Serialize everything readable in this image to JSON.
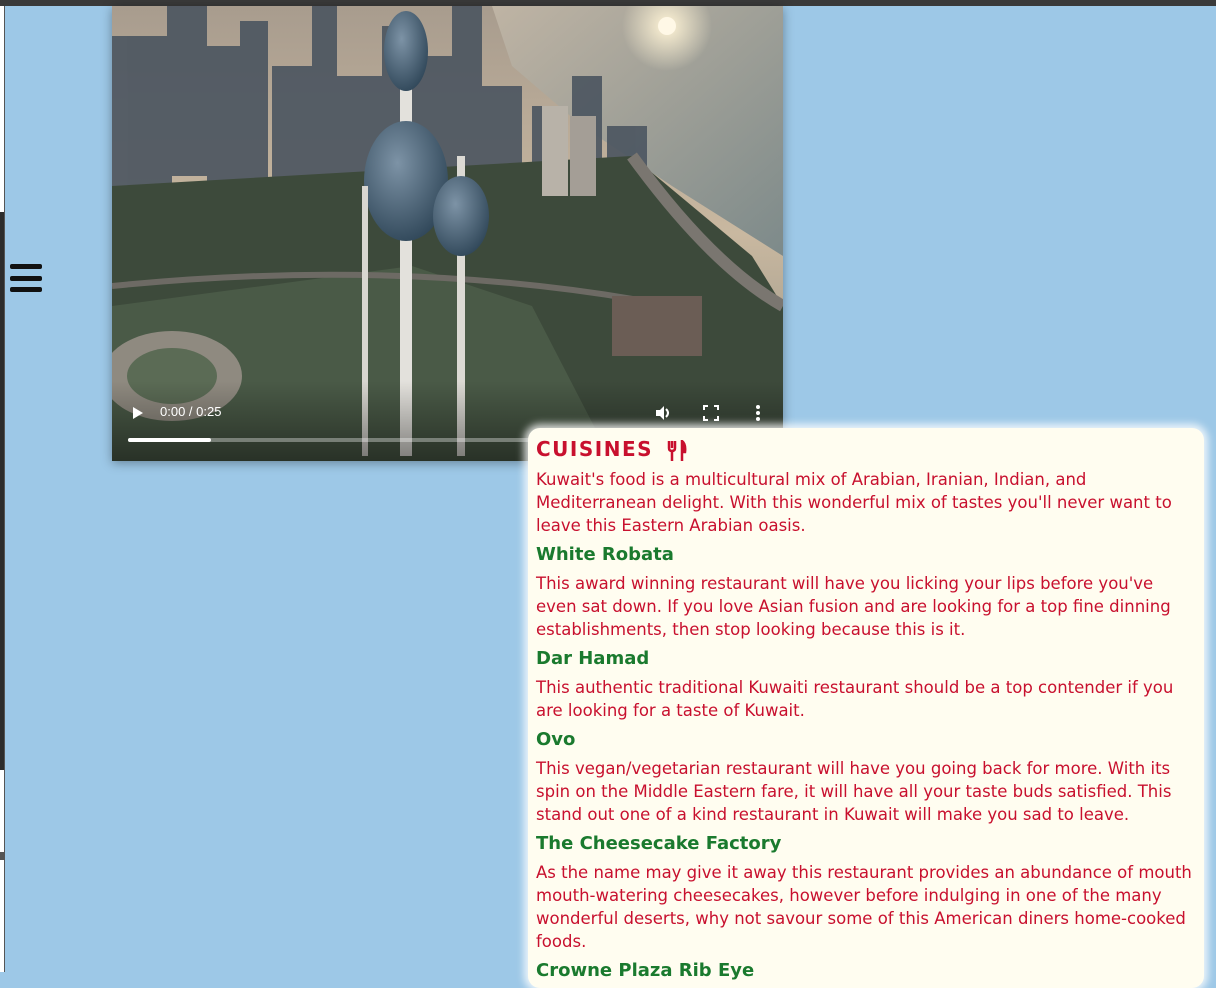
{
  "nav": {
    "menu_icon": "hamburger-menu-icon"
  },
  "video": {
    "time_display": "0:00 / 0:25",
    "progress": 0.13,
    "icons": [
      "play-icon",
      "volume-icon",
      "fullscreen-icon",
      "more-options-icon"
    ]
  },
  "cuisines": {
    "title": "CUISINES",
    "title_icon": "fork-knife-icon",
    "intro": "Kuwait's food is a multicultural mix of Arabian, Iranian, Indian, and Mediterranean delight. With this wonderful mix of tastes you'll never want to leave this Eastern Arabian oasis.",
    "restaurants": [
      {
        "name": "White Robata",
        "description": "This award winning restaurant will have you licking your lips before you've even sat down. If you love Asian fusion and are looking for a top fine dinning establishments, then stop looking because this is it."
      },
      {
        "name": "Dar Hamad",
        "description": "This authentic traditional Kuwaiti restaurant should be a top contender if you are looking for a taste of Kuwait."
      },
      {
        "name": "Ovo",
        "description": "This vegan/vegetarian restaurant will have you going back for more. With its spin on the Middle Eastern fare, it will have all your taste buds satisfied. This stand out one of a kind restaurant in Kuwait will make you sad to leave."
      },
      {
        "name": "The Cheesecake Factory",
        "description": "As the name may give it away this restaurant provides an abundance of mouth mouth-watering cheesecakes, however before indulging in one of the many wonderful deserts, why not savour some of this American diners home-cooked foods."
      },
      {
        "name": "Crowne Plaza Rib Eye",
        "description": ""
      }
    ]
  }
}
